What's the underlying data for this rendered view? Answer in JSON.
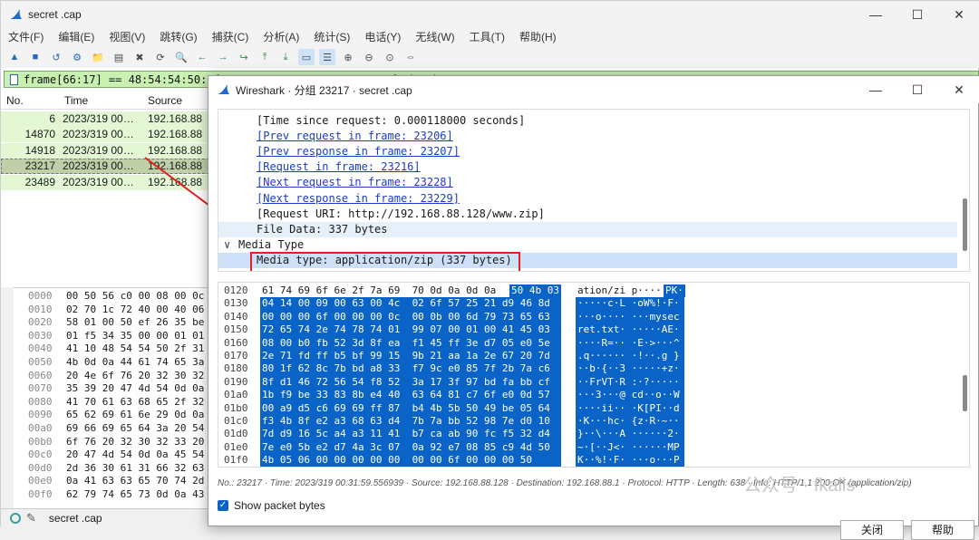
{
  "main_window": {
    "title": "secret .cap",
    "controls": {
      "min": "—",
      "max": "☐",
      "close": "✕"
    },
    "menu": [
      "文件(F)",
      "编辑(E)",
      "视图(V)",
      "跳转(G)",
      "捕获(C)",
      "分析(A)",
      "统计(S)",
      "电话(Y)",
      "无线(W)",
      "工具(T)",
      "帮助(H)"
    ],
    "toolbar_icons": [
      "shark-fin-icon",
      "stop-icon",
      "restart-icon",
      "options-icon",
      "open-icon",
      "save-icon",
      "close-file-icon",
      "reload-icon",
      "find-icon",
      "back-icon",
      "forward-icon",
      "goto-icon",
      "first-icon",
      "last-icon",
      "autoscroll-icon",
      "colorize-icon",
      "zoom-in-icon",
      "zoom-out-icon",
      "zoom-reset-icon",
      "resize-columns-icon"
    ],
    "filter_text": "frame[66:17] == 48:54:54:50:2f:31:2e:31:20:32:30:30:20:4f:4b:0d:0a",
    "packet_list": {
      "headers": [
        "No.",
        "Time",
        "Source"
      ],
      "rows": [
        {
          "no": "6",
          "time": "2023/319 00…",
          "src": "192.168.88"
        },
        {
          "no": "14870",
          "time": "2023/319 00…",
          "src": "192.168.88"
        },
        {
          "no": "14918",
          "time": "2023/319 00…",
          "src": "192.168.88"
        },
        {
          "no": "23217",
          "time": "2023/319 00…",
          "src": "192.168.88"
        },
        {
          "no": "23489",
          "time": "2023/319 00…",
          "src": "192.168.88"
        }
      ]
    },
    "bg_hex_rows": [
      {
        "off": "0000",
        "bytes": "00 50 56 c0 00 08 00 0c"
      },
      {
        "off": "0010",
        "bytes": "02 70 1c 72 40 00 40 06"
      },
      {
        "off": "0020",
        "bytes": "58 01 00 50 ef 26 35 be"
      },
      {
        "off": "0030",
        "bytes": "01 f5 34 35 00 00 01 01"
      },
      {
        "off": "0040",
        "bytes": "41 10 48 54 54 50 2f 31"
      },
      {
        "off": "0050",
        "bytes": "4b 0d 0a 44 61 74 65 3a"
      },
      {
        "off": "0060",
        "bytes": "20 4e 6f 76 20 32 30 32"
      },
      {
        "off": "0070",
        "bytes": "35 39 20 47 4d 54 0d 0a"
      },
      {
        "off": "0080",
        "bytes": "41 70 61 63 68 65 2f 32"
      },
      {
        "off": "0090",
        "bytes": "65 62 69 61 6e 29 0d 0a"
      },
      {
        "off": "00a0",
        "bytes": "69 66 69 65 64 3a 20 54"
      },
      {
        "off": "00b0",
        "bytes": "6f 76 20 32 30 32 33 20"
      },
      {
        "off": "00c0",
        "bytes": "20 47 4d 54 0d 0a 45 54"
      },
      {
        "off": "00d0",
        "bytes": "2d 36 30 61 31 66 32 63"
      },
      {
        "off": "00e0",
        "bytes": "0a 41 63 63 65 70 74 2d"
      },
      {
        "off": "00f0",
        "bytes": "62 79 74 65 73 0d 0a 43"
      }
    ],
    "status_file": "secret .cap"
  },
  "dialog": {
    "title": "Wireshark · 分组 23217 · secret .cap",
    "controls": {
      "min": "—",
      "max": "☐",
      "close": "✕"
    },
    "tree": [
      {
        "text": "[Time since request: 0.000118000 seconds]",
        "link": false,
        "indent": 1
      },
      {
        "text": "[Prev request in frame: 23206]",
        "link": true,
        "indent": 1
      },
      {
        "text": "[Prev response in frame: 23207]",
        "link": true,
        "indent": 1
      },
      {
        "text": "[Request in frame: 23216]",
        "link": true,
        "indent": 1
      },
      {
        "text": "[Next request in frame: 23228]",
        "link": true,
        "indent": 1
      },
      {
        "text": "[Next response in frame: 23229]",
        "link": true,
        "indent": 1
      },
      {
        "text": "[Request URI: http://192.168.88.128/www.zip]",
        "link": false,
        "indent": 1
      },
      {
        "text": "File Data: 337 bytes",
        "link": false,
        "indent": 1
      },
      {
        "text": "Media Type",
        "link": false,
        "indent": 0,
        "expander": "∨"
      },
      {
        "text": "Media type: application/zip (337 bytes)",
        "link": false,
        "indent": 1
      }
    ],
    "hex": [
      {
        "off": "0120",
        "plain": "61 74 69 6f 6e 2f 7a 69  70 0d 0a 0d 0a ",
        "sel": "50 4b 03",
        "ascii_plain": "ation/zi p····",
        "ascii_sel": "PK·"
      },
      {
        "off": "0130",
        "plain": "",
        "sel": "04 14 00 09 00 63 00 4c  02 6f 57 25 21 d9 46 8d",
        "ascii_plain": "",
        "ascii_sel": "·····c·L ·oW%!·F·"
      },
      {
        "off": "0140",
        "plain": "",
        "sel": "00 00 00 6f 00 00 00 0c  00 0b 00 6d 79 73 65 63",
        "ascii_plain": "",
        "ascii_sel": "···o···· ···mysec"
      },
      {
        "off": "0150",
        "plain": "",
        "sel": "72 65 74 2e 74 78 74 01  99 07 00 01 00 41 45 03",
        "ascii_plain": "",
        "ascii_sel": "ret.txt· ·····AE·"
      },
      {
        "off": "0160",
        "plain": "",
        "sel": "08 00 b0 fb 52 3d 8f ea  f1 45 ff 3e d7 05 e0 5e",
        "ascii_plain": "",
        "ascii_sel": "····R=·· ·E·>···^"
      },
      {
        "off": "0170",
        "plain": "",
        "sel": "2e 71 fd ff b5 bf 99 15  9b 21 aa 1a 2e 67 20 7d",
        "ascii_plain": "",
        "ascii_sel": ".q······ ·!··.g }"
      },
      {
        "off": "0180",
        "plain": "",
        "sel": "80 1f 62 8c 7b bd a8 33  f7 9c e0 85 7f 2b 7a c6",
        "ascii_plain": "",
        "ascii_sel": "··b·{··3 ·····+z·"
      },
      {
        "off": "0190",
        "plain": "",
        "sel": "8f d1 46 72 56 54 f8 52  3a 17 3f 97 bd fa bb cf",
        "ascii_plain": "",
        "ascii_sel": "··FrVT·R :·?·····"
      },
      {
        "off": "01a0",
        "plain": "",
        "sel": "1b f9 be 33 83 8b e4 40  63 64 81 c7 6f e0 0d 57",
        "ascii_plain": "",
        "ascii_sel": "···3···@ cd··o··W"
      },
      {
        "off": "01b0",
        "plain": "",
        "sel": "00 a9 d5 c6 69 69 ff 87  b4 4b 5b 50 49 be 05 64",
        "ascii_plain": "",
        "ascii_sel": "····ii·· ·K[PI··d"
      },
      {
        "off": "01c0",
        "plain": "",
        "sel": "f3 4b 8f e2 a3 68 63 d4  7b 7a bb 52 98 7e d0 10",
        "ascii_plain": "",
        "ascii_sel": "·K···hc· {z·R·~··"
      },
      {
        "off": "01d0",
        "plain": "",
        "sel": "7d d9 16 5c a4 a3 11 41  b7 ca ab 90 fc f5 32 d4",
        "ascii_plain": "",
        "ascii_sel": "}··\\···A ······2·"
      },
      {
        "off": "01e0",
        "plain": "",
        "sel": "7e e0 5b e2 d7 4a 3c 07  0a 92 e7 08 85 c9 4d 50",
        "ascii_plain": "",
        "ascii_sel": "~·[··J<· ······MP"
      },
      {
        "off": "01f0",
        "plain": "",
        "sel": "4b 05 06 00 00 00 00 00  00 00 6f 00 00 00 50",
        "ascii_plain": "",
        "ascii_sel": "K··%!·F· ···o···P"
      }
    ],
    "status_line": "No.: 23217 · Time: 2023/319 00:31:59.556939 · Source: 192.168.88.128 · Destination: 192.168.88.1 · Protocol: HTTP · Length: 638 · Info: HTTP/1.1 200 OK (application/zip)",
    "show_bytes_label": "Show packet bytes",
    "close_button": "关闭",
    "help_button": "帮助"
  },
  "watermark": "公众号 · fkalis",
  "colors": {
    "filter_bg": "#c8f0b0",
    "row_green": "#e4f7d4",
    "row_sel": "#bfcfa8",
    "hex_sel": "#0a64c8",
    "highlight_box": "#e02020",
    "arrow": "#e02020",
    "link": "#1a3cc8"
  }
}
